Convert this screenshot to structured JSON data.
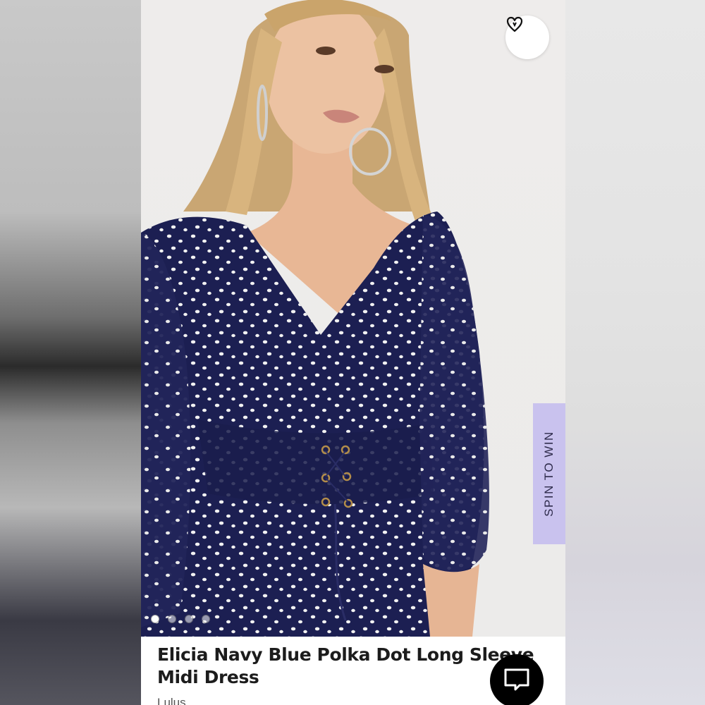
{
  "product": {
    "title_line1": "Elicia Navy Blue Polka Dot Long Sleeve",
    "title_line2": "Midi Dress",
    "brand": "Lulus"
  },
  "promo": {
    "spin_label": "SPIN TO WIN"
  },
  "gallery": {
    "image_count": 4,
    "active_index": 0
  },
  "icons": {
    "wishlist": "heart-outline-icon",
    "chat": "chat-bubble-icon"
  },
  "colors": {
    "dress": "#1c1f52",
    "spin_tab": "#c9c2ee",
    "chat_button": "#000000"
  }
}
